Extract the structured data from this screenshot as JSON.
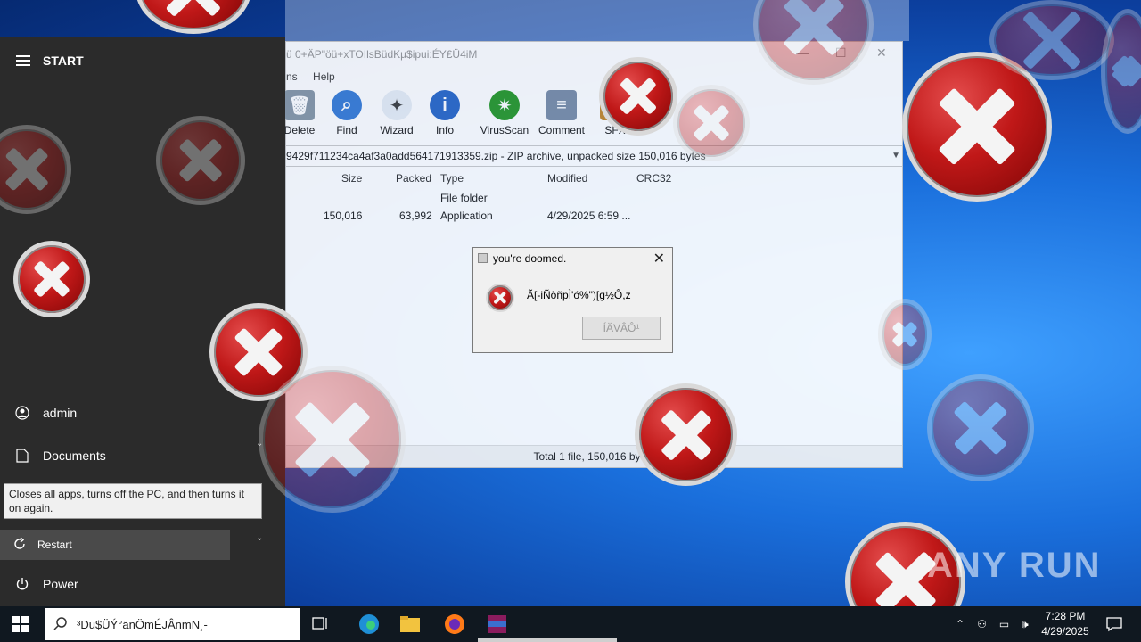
{
  "start_menu": {
    "title": "START",
    "user": "admin",
    "documents": "Documents",
    "tooltip": "Closes all apps, turns off the PC, and then turns it on again.",
    "restart": "Restart",
    "power": "Power"
  },
  "winrar": {
    "title": "ü 0+ÄP\"öü+xTOIlsBüdKµ$ipui:ÉY£Ü4iM",
    "menu": [
      "ns",
      "Help"
    ],
    "toolbar": [
      "Delete",
      "Find",
      "Wizard",
      "Info",
      "VirusScan",
      "Comment",
      "SFX"
    ],
    "path": "9429f711234ca4af3a0add564171913359.zip - ZIP archive, unpacked size 150,016 bytes",
    "columns": [
      "Size",
      "Packed",
      "Type",
      "Modified",
      "CRC32"
    ],
    "rows": [
      {
        "size": "",
        "packed": "",
        "type": "File folder",
        "modified": "",
        "crc": ""
      },
      {
        "size": "150,016",
        "packed": "63,992",
        "type": "Application",
        "modified": "4/29/2025 6:59 ...",
        "crc": ""
      }
    ],
    "status": "Total 1 file, 150,016 bytes"
  },
  "dialog": {
    "title": "you're doomed.",
    "message": "Ã[-iÑòñpÌ'ó%\")[g½Ô,z",
    "button": "ÍÄVÂÔ¹"
  },
  "taskbar": {
    "search_text": "³Du$ÜÝ°änÖmÉJÂnmN¸-",
    "time": "7:28 PM",
    "date": "4/29/2025"
  },
  "watermark": "ANY RUN",
  "colors": {
    "desktop_blue": "#1a6fdc",
    "start_bg": "#2b2b2b",
    "error_red": "#c01818",
    "taskbar": "#101820"
  }
}
